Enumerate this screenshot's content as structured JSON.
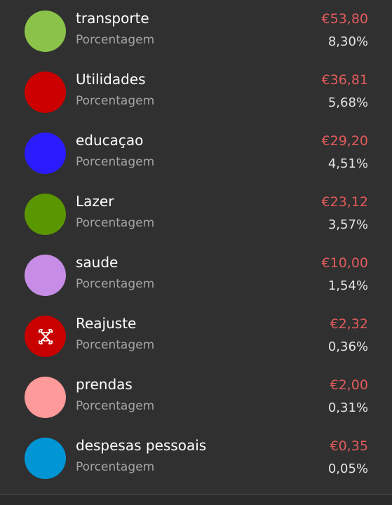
{
  "subtitle_label": "Porcentagem",
  "categories": [
    {
      "name": "transporte",
      "amount": "€53,80",
      "percent": "8,30%",
      "color": "#8bc34a",
      "icon": null
    },
    {
      "name": "Utilidades",
      "amount": "€36,81",
      "percent": "5,68%",
      "color": "#cc0000",
      "icon": null
    },
    {
      "name": "educaçao",
      "amount": "€29,20",
      "percent": "4,51%",
      "color": "#2b1bff",
      "icon": null
    },
    {
      "name": "Lazer",
      "amount": "€23,12",
      "percent": "3,57%",
      "color": "#5a9600",
      "icon": null
    },
    {
      "name": "saude",
      "amount": "€10,00",
      "percent": "1,54%",
      "color": "#c78de6",
      "icon": null
    },
    {
      "name": "Reajuste",
      "amount": "€2,32",
      "percent": "0,36%",
      "color": "#c80000",
      "icon": "crossed-tools-icon"
    },
    {
      "name": "prendas",
      "amount": "€2,00",
      "percent": "0,31%",
      "color": "#ff9a9a",
      "icon": null
    },
    {
      "name": "despesas pessoais",
      "amount": "€0,35",
      "percent": "0,05%",
      "color": "#0096d6",
      "icon": null
    }
  ],
  "colors": {
    "background": "#303030",
    "amount_text": "#e25b5b",
    "percent_text": "#e4e4e4",
    "subtitle_text": "#a3a3a3"
  }
}
